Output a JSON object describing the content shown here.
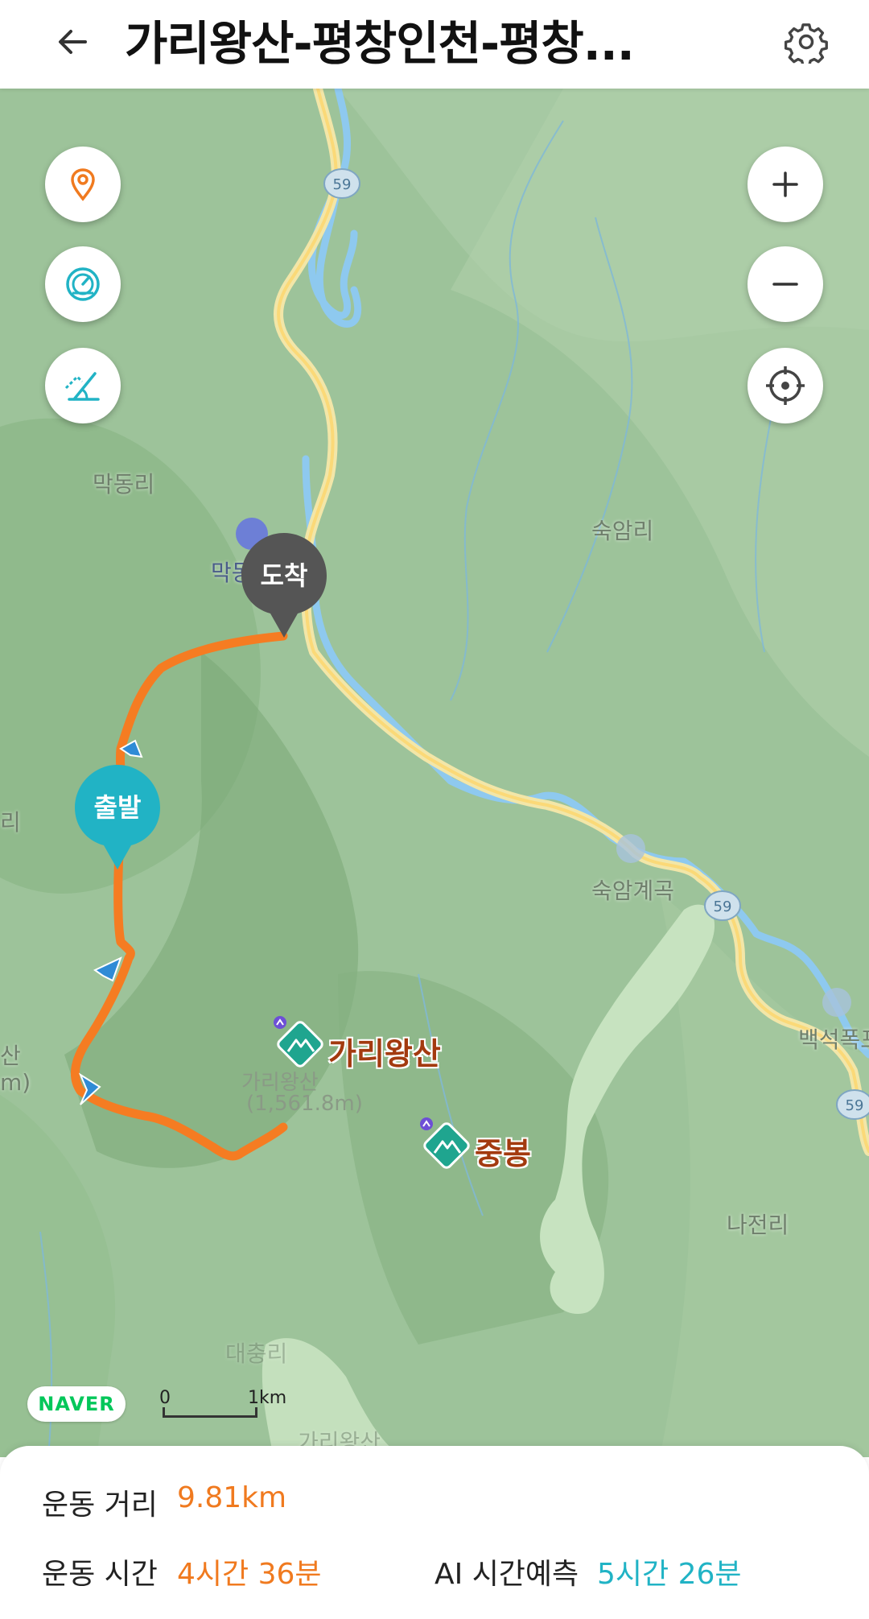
{
  "header": {
    "title": "가리왕산-평창인천-평창..."
  },
  "map": {
    "places": {
      "makdong": "막동리",
      "makdong_poi": "막동",
      "sugam": "숙암리",
      "sugam_valley": "숙암계곡",
      "baekseok": "백석폭포",
      "najeon": "나전리",
      "left_edge": "리",
      "left_edge2": "산",
      "left_edge3": "m)",
      "bottom_faded": "가리왕산",
      "bottom_faded2": "대충리"
    },
    "road_badges": [
      "59",
      "59",
      "59"
    ],
    "peaks": {
      "gariwang": "가리왕산",
      "gariwang_height": "(1,561.8m)",
      "jungbong": "중봉"
    },
    "pins": {
      "arrive": "도착",
      "start": "출발"
    },
    "naver": "NAVER",
    "scale": {
      "zero": "0",
      "one": "1km"
    },
    "colors": {
      "route": "#f57c22",
      "start_pin": "#21b3c5",
      "arrive_pin": "#555555",
      "road": "#fbe58f",
      "river": "#8ec9ef"
    }
  },
  "stats": {
    "distance_label": "운동 거리",
    "distance_value": "9.81km",
    "time_label": "운동 시간",
    "time_value": "4시간 36분",
    "ai_label": "AI 시간예측",
    "ai_value": "5시간 26분"
  }
}
